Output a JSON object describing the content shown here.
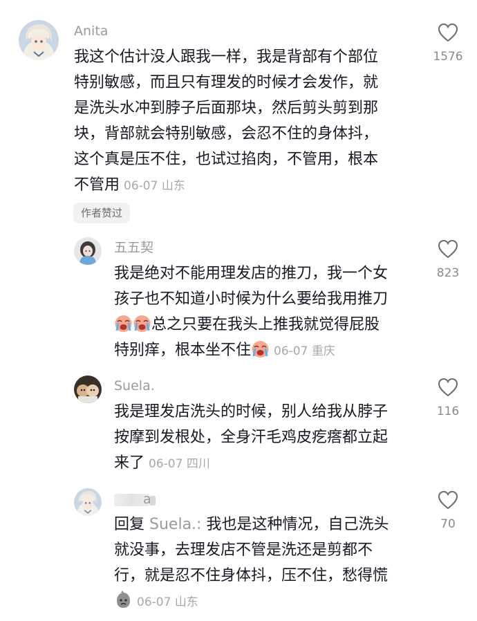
{
  "comments": [
    {
      "username": "Anita",
      "lines": [
        "我这个估计没人跟我一样，我是背部有个部位",
        "特别敏感，而且只有理发的时候才会发作，就",
        "是洗头水冲到脖子后面那块，然后剪头剪到那",
        "块，背部就会特别敏感，会忍不住的身体抖，",
        "这个真是压不住，也试过掐肉，不管用，根本",
        "不管用"
      ],
      "date": "06-07",
      "location": "山东",
      "likes": "1576",
      "badge": "作者赞过"
    },
    {
      "username": "五五契",
      "line1": "我是绝对不能用理发店的推刀，我一个女",
      "line2": "孩子也不知道小时候为什么要给我用推刀",
      "line3_text": "总之只要在我头上推我就觉得屁股",
      "line4_text": "特别痒，根本坐不住",
      "emoji": "loudly-crying-face",
      "date": "06-07",
      "location": "重庆",
      "likes": "823"
    },
    {
      "username": "Suela.",
      "lines": [
        "我是理发店洗头的时候，别人给我从脖子",
        "按摩到发根处，全身汗毛鸡皮疙瘩都立起",
        "来了"
      ],
      "date": "06-07",
      "location": "四川",
      "likes": "116"
    },
    {
      "username_visible": "a",
      "reply_label": "回复",
      "reply_target": "Suela.:",
      "line1_text": "我也是这种情况，自己洗头",
      "lines": [
        "就没事，去理发店不管是洗还是剪都不",
        "行，就是忍不住身体抖，压不住，愁得慌"
      ],
      "emoji": "gray-sad-face",
      "date": "06-07",
      "location": "山东",
      "likes": "70"
    }
  ],
  "colors": {
    "text": "#161823",
    "meta": "#a8a8a8",
    "username": "#9a9a9a",
    "badge_bg": "#f1f1f2"
  }
}
